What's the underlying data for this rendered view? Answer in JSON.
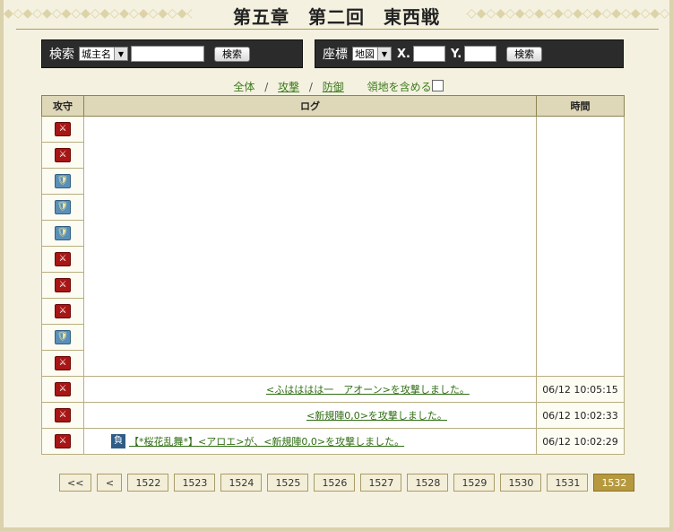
{
  "header": {
    "title": "第五章　第二回　東西戦"
  },
  "search_panel": {
    "label": "検索",
    "type_selected": "城主名",
    "query_value": "",
    "button_label": "検索"
  },
  "coord_panel": {
    "label": "座標",
    "map_selected": "地図",
    "x_label": "X.",
    "y_label": "Y.",
    "x_value": "",
    "y_value": "",
    "button_label": "検索"
  },
  "filters": {
    "all_label": "全体",
    "attack_label": "攻撃",
    "defense_label": "防御",
    "separator": "/",
    "include_territory_label": "領地を含める"
  },
  "table": {
    "headers": {
      "type": "攻守",
      "log": "ログ",
      "time": "時間"
    },
    "rows": [
      {
        "type": "attack",
        "message": "",
        "time": ""
      },
      {
        "type": "attack",
        "message": "",
        "time": ""
      },
      {
        "type": "defense",
        "message": "",
        "time": ""
      },
      {
        "type": "defense",
        "message": "",
        "time": ""
      },
      {
        "type": "defense",
        "message": "",
        "time": ""
      },
      {
        "type": "attack",
        "message": "",
        "time": ""
      },
      {
        "type": "attack",
        "message": "",
        "time": ""
      },
      {
        "type": "attack",
        "message": "",
        "time": ""
      },
      {
        "type": "defense",
        "message": "",
        "time": ""
      },
      {
        "type": "attack",
        "message": "",
        "time": ""
      },
      {
        "type": "attack",
        "message": "<ふはははは一　アオーン>を攻撃しました。",
        "time": "06/12 10:05:15"
      },
      {
        "type": "attack",
        "message": "<新規陣0,0>を攻撃しました。",
        "time": "06/12 10:02:33"
      },
      {
        "type": "attack",
        "badge": "負",
        "message": "【*桜花乱舞*】<アロエ>が、<新規陣0,0>を攻撃しました。",
        "time": "06/12 10:02:29"
      }
    ]
  },
  "pagination": {
    "first_label": "<<",
    "prev_label": "<",
    "pages": [
      "1522",
      "1523",
      "1524",
      "1525",
      "1526",
      "1527",
      "1528",
      "1529",
      "1530",
      "1531",
      "1532"
    ],
    "current": "1532"
  },
  "colors": {
    "accent": "#b6993e",
    "attack": "#a81515",
    "defense": "#5a90b8",
    "link": "#2f6e12"
  }
}
